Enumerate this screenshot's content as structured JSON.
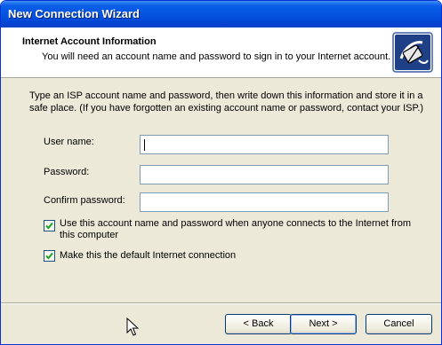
{
  "window": {
    "title": "New Connection Wizard"
  },
  "header": {
    "title": "Internet Account Information",
    "subtitle": "You will need an account name and password to sign in to your Internet account.",
    "icon": "network-phone-icon"
  },
  "instructions": "Type an ISP account name and password, then write down this information and store it in a safe place. (If you have forgotten an existing account name or password, contact your ISP.)",
  "fields": {
    "username": {
      "label": "User name:",
      "value": ""
    },
    "password": {
      "label": "Password:",
      "value": ""
    },
    "confirm": {
      "label": "Confirm password:",
      "value": ""
    }
  },
  "checkboxes": {
    "use_for_all": {
      "label": "Use this account  name and password when anyone connects to the Internet from this computer",
      "checked": true
    },
    "default_connection": {
      "label": "Make this the default Internet connection",
      "checked": true
    }
  },
  "buttons": {
    "back": "< Back",
    "next": "Next >",
    "cancel": "Cancel"
  },
  "colors": {
    "titlebar": "#0453e0",
    "dialog_bg": "#ece9d8",
    "input_border": "#7f9db9",
    "check_mark": "#21a121"
  }
}
